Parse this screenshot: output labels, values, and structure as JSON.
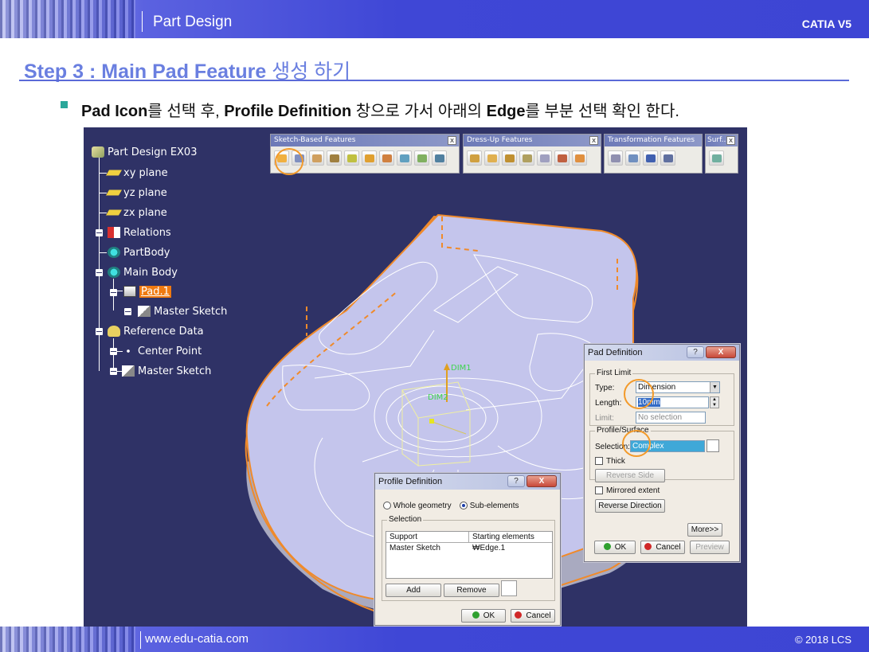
{
  "header": {
    "section": "Part Design",
    "brand": "CATIA V5"
  },
  "footer": {
    "site": "www.edu-catia.com",
    "copyright": "© 2018 LCS"
  },
  "step": {
    "title_en": "Step 3 : Main Pad Feature",
    "title_kr": "생성 하기"
  },
  "instruction": {
    "p1": "Pad Icon",
    "p2": "를 선택 후, ",
    "p3": "Profile Definition",
    "p4": " 창으로 가서 아래의 ",
    "p5": "Edge",
    "p6": "를 부분 선택 확인 한다."
  },
  "tree": {
    "root": "Part Design EX03",
    "xy": "xy plane",
    "yz": "yz plane",
    "zx": "zx plane",
    "relations": "Relations",
    "partbody": "PartBody",
    "mainbody": "Main Body",
    "pad": "Pad.1",
    "master_sketch_1": "Master Sketch",
    "refdata": "Reference Data",
    "center_point": "Center Point",
    "master_sketch_2": "Master Sketch"
  },
  "toolbars": {
    "sketch": "Sketch-Based Features",
    "dressup": "Dress-Up Features",
    "transform": "Transformation Features",
    "surf": "Surf...",
    "close": "x"
  },
  "model_labels": {
    "dim1": "DIM1",
    "dim2": "DIM2"
  },
  "pad_dialog": {
    "title": "Pad Definition",
    "help": "?",
    "close": "X",
    "first_limit": "First Limit",
    "type_label": "Type:",
    "type_value": "Dimension",
    "length_label": "Length:",
    "length_value": "10mm",
    "limit_label": "Limit:",
    "limit_value": "No selection",
    "profile_surface": "Profile/Surface",
    "selection_label": "Selection:",
    "selection_value": "Complex",
    "thick": "Thick",
    "reverse_side": "Reverse Side",
    "mirrored": "Mirrored extent",
    "reverse_dir": "Reverse Direction",
    "more": "More>>",
    "ok": "OK",
    "cancel": "Cancel",
    "preview": "Preview"
  },
  "profile_dialog": {
    "title": "Profile Definition",
    "help": "?",
    "close": "X",
    "whole": "Whole geometry",
    "sub": "Sub-elements",
    "selection": "Selection",
    "col_support": "Support",
    "col_start": "Starting elements",
    "row_support": "Master Sketch",
    "row_start": "₩Edge.1",
    "add": "Add",
    "remove": "Remove",
    "ok": "OK",
    "cancel": "Cancel"
  },
  "colors": {
    "accent": "#6a7fe0",
    "highlight": "#f39a2a",
    "viewport": "#2f3266",
    "bar": "#3f47d6"
  }
}
